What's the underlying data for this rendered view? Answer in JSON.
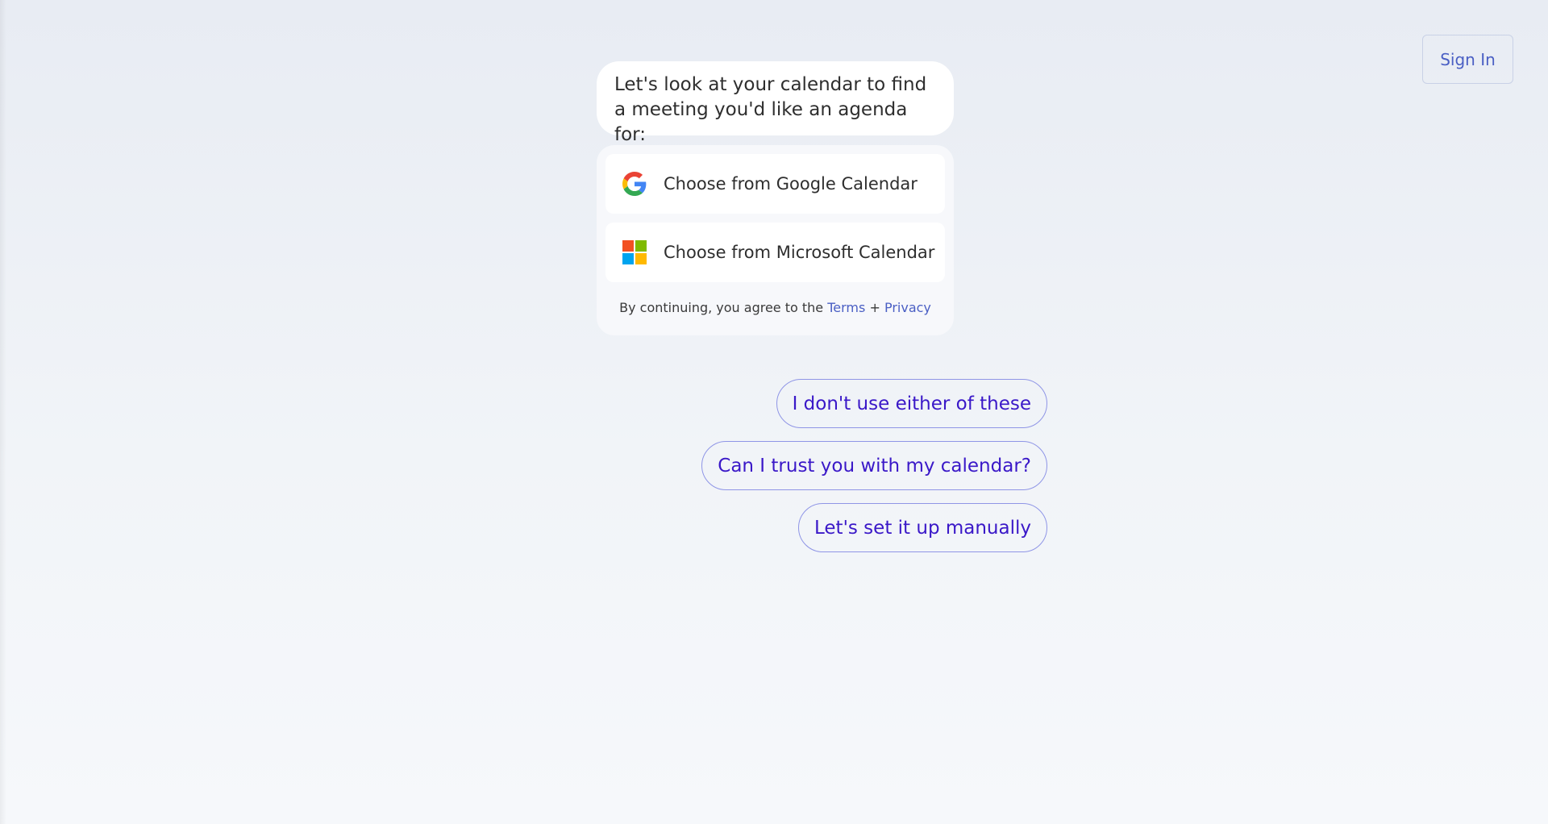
{
  "header": {
    "sign_in_label": "Sign In"
  },
  "chat": {
    "assistant_message": "Let's look at your calendar to find a meeting you'd like an agenda for:"
  },
  "calendar_card": {
    "options": [
      {
        "label": "Choose from Google Calendar",
        "icon": "google-logo-icon"
      },
      {
        "label": "Choose from Microsoft Calendar",
        "icon": "microsoft-logo-icon"
      }
    ],
    "consent": {
      "prefix": "By continuing, you agree to the",
      "terms_label": "Terms",
      "separator": "+",
      "privacy_label": "Privacy"
    }
  },
  "suggestions": [
    {
      "label": "I don't use either of these"
    },
    {
      "label": "Can I trust you with my calendar?"
    },
    {
      "label": "Let's set it up manually"
    }
  ],
  "colors": {
    "accent": "#4a5fc4",
    "suggestion_text": "#3a18c8",
    "suggestion_border": "#8f95e6",
    "google_blue": "#4285F4",
    "google_red": "#EA4335",
    "google_yellow": "#FBBC05",
    "google_green": "#34A853",
    "ms_red": "#F25022",
    "ms_green": "#7FBA00",
    "ms_blue": "#00A4EF",
    "ms_yellow": "#FFB900"
  }
}
